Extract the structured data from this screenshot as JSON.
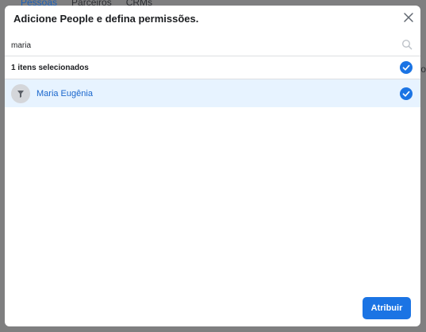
{
  "background": {
    "tabs": [
      "Pessoas",
      "Parceiros",
      "CRMs"
    ],
    "right_text": "ro"
  },
  "dialog": {
    "title": "Adicione People e defina permissões.",
    "close_icon": "close-icon",
    "search": {
      "value": "maria",
      "icon": "search-icon"
    },
    "selected_count_label": "1 itens selecionados",
    "items": [
      {
        "label": "Maria Eugênia",
        "selected": true
      }
    ],
    "assign_button": "Atribuir"
  },
  "colors": {
    "accent": "#1b74e4",
    "selected_row": "#e7f3ff",
    "check": "#1b74e4",
    "overlay": "#7f7f80"
  }
}
